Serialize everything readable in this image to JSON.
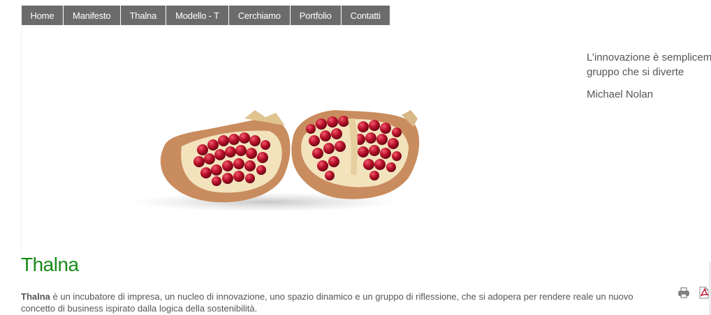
{
  "nav": {
    "items": [
      {
        "label": "Home"
      },
      {
        "label": "Manifesto"
      },
      {
        "label": "Thalna"
      },
      {
        "label": "Modello - T"
      },
      {
        "label": "Cerchiamo"
      },
      {
        "label": "Portfolio"
      },
      {
        "label": "Contatti"
      }
    ]
  },
  "quote": {
    "line1": "L’innovazione è semplicem",
    "line2": "gruppo che si diverte",
    "author": "Michael Nolan"
  },
  "hero": {
    "image": "pomegranate-halves",
    "colors": {
      "seeds": "#b8102a",
      "rind": "#c98c5e",
      "pith": "#f2e3bd"
    }
  },
  "article": {
    "title": "Thalna",
    "intro_bold": "Thalna",
    "intro_text": " è un incubatore di impresa, un nucleo di innovazione, uno spazio dinamico e un gruppo di riflessione, che si adopera per rendere reale un nuovo concetto di business ispirato dalla logica della sostenibilità."
  },
  "icons": {
    "print": "print-icon",
    "pdf": "pdf-icon"
  },
  "colors": {
    "nav_bg": "#6b6b6b",
    "title": "#1a8a1a",
    "text": "#555555"
  }
}
